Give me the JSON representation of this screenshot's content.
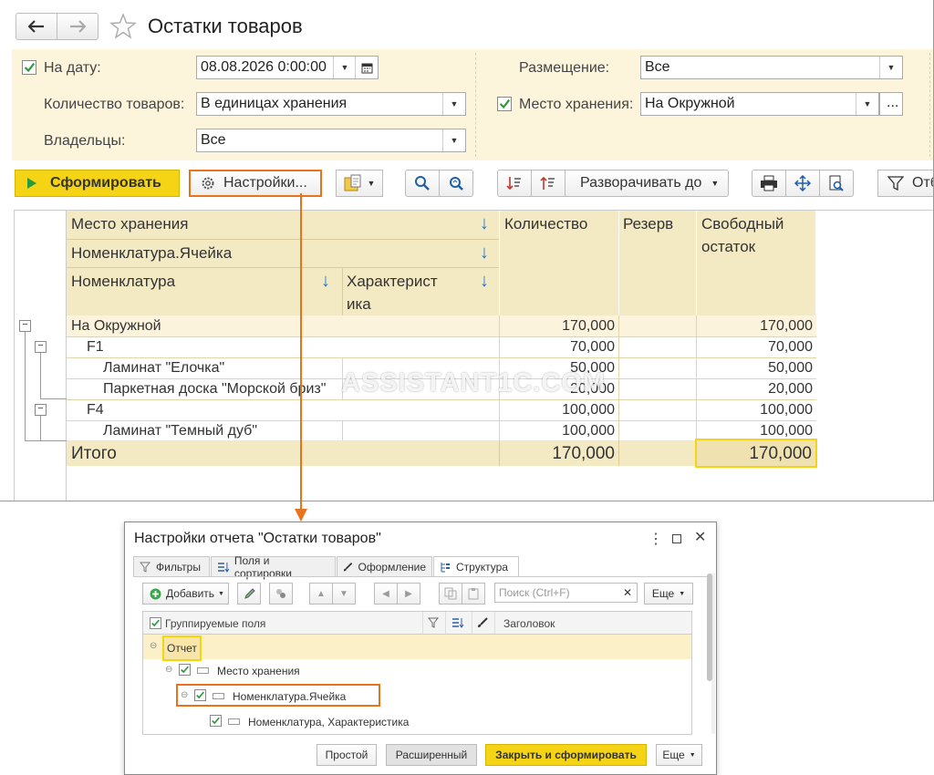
{
  "window": {
    "title": "Остатки товаров",
    "back_icon": "arrow-left-icon",
    "forward_icon": "arrow-right-icon",
    "favorite_icon": "star-icon"
  },
  "filters": {
    "date_label": "На дату:",
    "date_value": "08.08.2026  0:00:00",
    "quantity_label": "Количество товаров:",
    "quantity_value": "В единицах хранения",
    "owners_label": "Владельцы:",
    "owners_value": "Все",
    "placement_label": "Размещение:",
    "placement_value": "Все",
    "storage_label": "Место хранения:",
    "storage_value": "На Окружной",
    "storage_more": "..."
  },
  "toolbar": {
    "generate": "Сформировать",
    "settings": "Настройки...",
    "expand_to": "Разворачивать до",
    "partial_label": "Отб"
  },
  "report": {
    "headers": {
      "storage": "Место хранения",
      "cell": "Номенклатура.Ячейка",
      "item": "Номенклатура",
      "characteristic_1": "Характерист",
      "characteristic_2": "ика",
      "quantity": "Количество",
      "reserve": "Резерв",
      "free_1": "Свободный",
      "free_2": "остаток"
    },
    "rows": [
      {
        "name": "На Окружной",
        "qty": "170,000",
        "free": "170,000"
      },
      {
        "name": "F1",
        "qty": "70,000",
        "free": "70,000"
      },
      {
        "name": "Ламинат \"Елочка\"",
        "qty": "50,000",
        "free": "50,000"
      },
      {
        "name": "Паркетная доска \"Морской бриз\"",
        "qty": "20,000",
        "free": "20,000"
      },
      {
        "name": "F4",
        "qty": "100,000",
        "free": "100,000"
      },
      {
        "name": "Ламинат \"Темный дуб\"",
        "qty": "100,000",
        "free": "100,000"
      }
    ],
    "total": {
      "label": "Итого",
      "qty": "170,000",
      "free": "170,000"
    }
  },
  "watermark": "ASSISTANT1C.COM",
  "dialog": {
    "title": "Настройки отчета \"Остатки товаров\"",
    "tabs": [
      "Фильтры",
      "Поля и сортировки",
      "Оформление",
      "Структура"
    ],
    "add": "Добавить",
    "search_placeholder": "Поиск (Ctrl+F)",
    "more": "Еще",
    "tree_header": "Группируемые поля",
    "col_title": "Заголовок",
    "tree": {
      "report": "Отчет",
      "storage": "Место хранения",
      "cell": "Номенклатура.Ячейка",
      "item": "Номенклатура, Характеристика"
    },
    "footer": {
      "simple": "Простой",
      "advanced": "Расширенный",
      "close_generate": "Закрыть и сформировать",
      "more": "Еще"
    }
  },
  "colors": {
    "accent_yellow": "#f5d415",
    "highlight_orange": "#e8731c",
    "filter_bg": "#fcf5dc",
    "header_bg": "#f3e9c3",
    "sort_arrow": "#1f77d0",
    "check_green": "#2a9a3a"
  }
}
